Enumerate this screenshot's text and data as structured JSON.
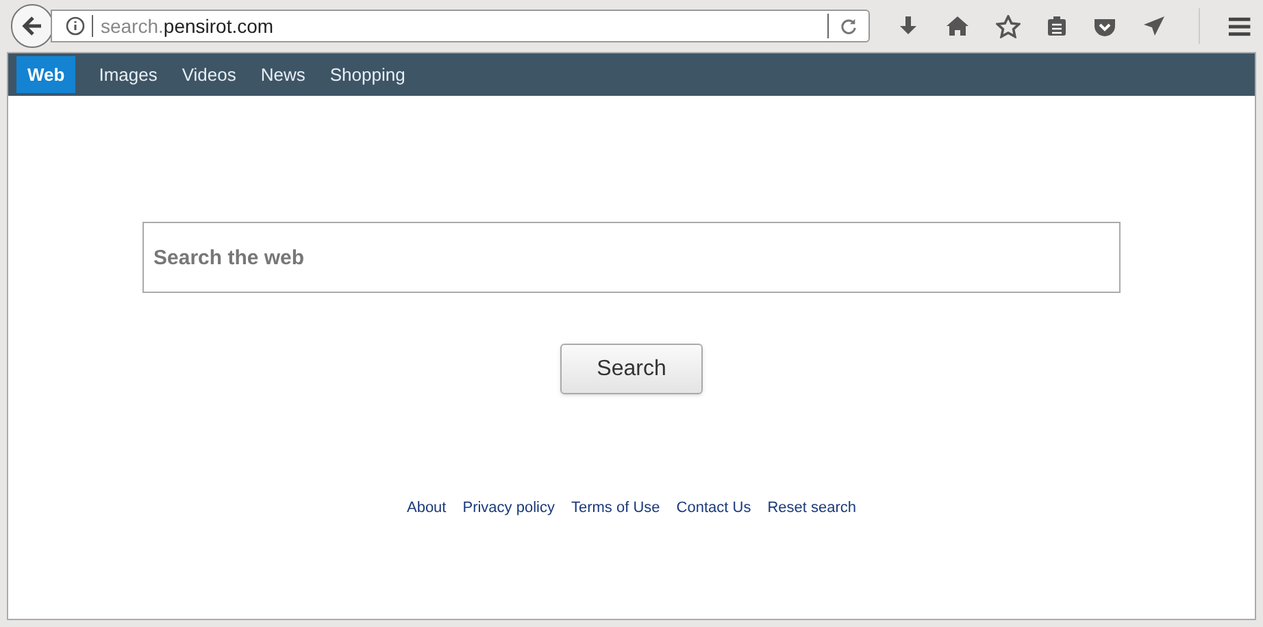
{
  "address_bar": {
    "url_prefix": "search.",
    "url_domain": "pensirot.com"
  },
  "nav_tabs": [
    {
      "label": "Web",
      "selected": true
    },
    {
      "label": "Images",
      "selected": false
    },
    {
      "label": "Videos",
      "selected": false
    },
    {
      "label": "News",
      "selected": false
    },
    {
      "label": "Shopping",
      "selected": false
    }
  ],
  "search": {
    "placeholder": "Search the web",
    "button": "Search"
  },
  "footer_links": [
    "About",
    "Privacy policy",
    "Terms of Use",
    "Contact Us",
    "Reset search"
  ]
}
